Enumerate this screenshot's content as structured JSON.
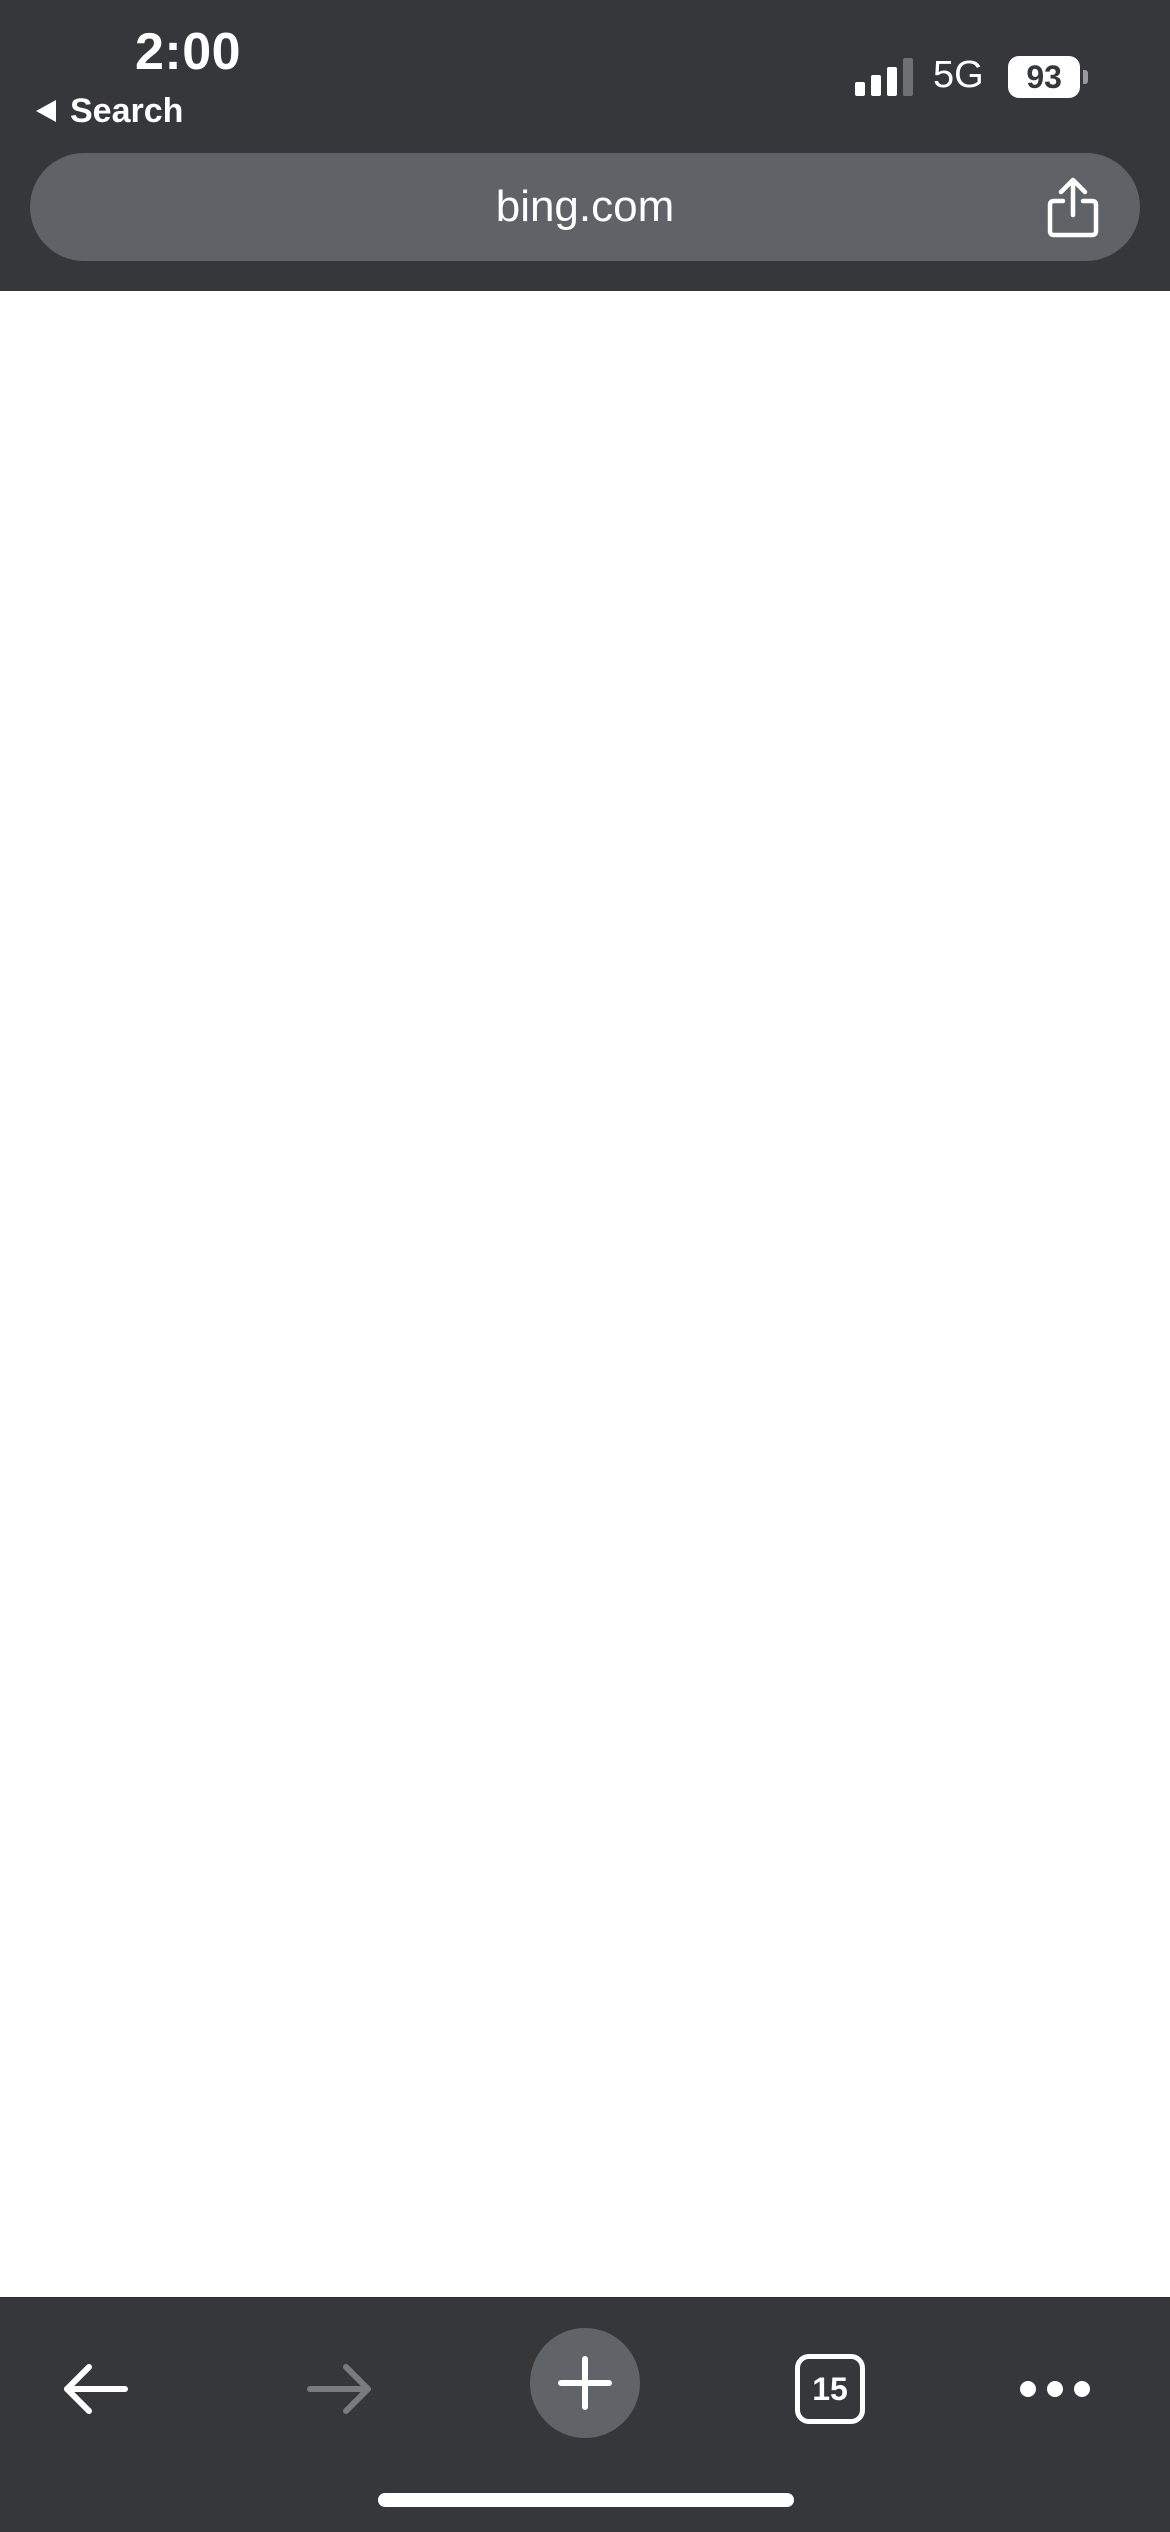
{
  "status_bar": {
    "time": "2:00",
    "back_label": "Search",
    "network": "5G",
    "battery": "93"
  },
  "address_bar": {
    "url": "bing.com"
  },
  "toolbar": {
    "tab_count": "15"
  },
  "colors": {
    "chrome": "#36373a",
    "url_bar": "#606368",
    "page": "#ffffff",
    "disabled_icon": "#7a7b7e"
  },
  "icons": {
    "share": "share-icon",
    "back": "arrow-left-icon",
    "forward": "arrow-right-icon",
    "new_tab": "plus-icon",
    "tabs": "tab-switcher-icon",
    "menu": "more-horizontal-icon",
    "signal": "cellular-signal-icon",
    "battery": "battery-icon"
  }
}
